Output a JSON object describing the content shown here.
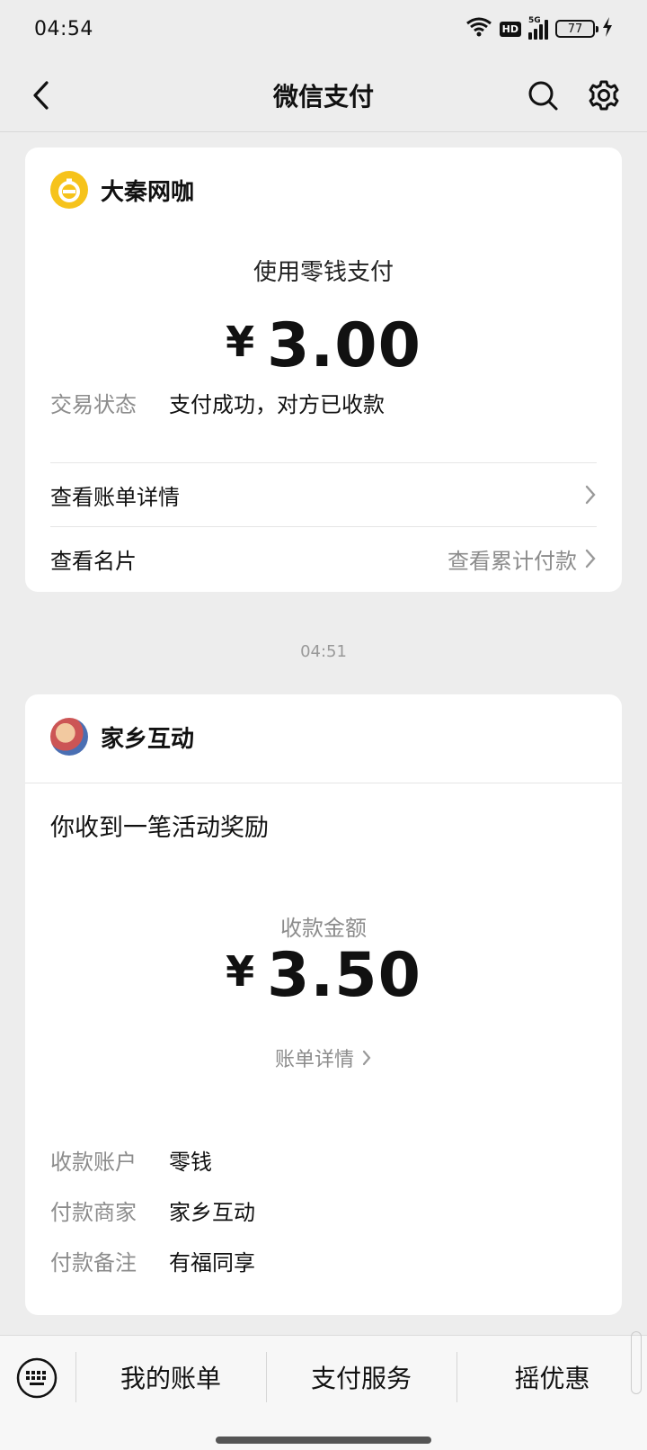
{
  "status": {
    "time": "04:54",
    "network": "5G",
    "hd": "HD",
    "battery": "77"
  },
  "nav": {
    "title": "微信支付"
  },
  "payment_card": {
    "merchant": "大秦网咖",
    "method": "使用零钱支付",
    "currency": "¥",
    "amount": "3.00",
    "status_key": "交易状态",
    "status_value": "支付成功，对方已收款",
    "bill_detail": "查看账单详情",
    "view_card": "查看名片",
    "view_total": "查看累计付款"
  },
  "timestamp": "04:51",
  "reward_card": {
    "merchant": "家乡互动",
    "message": "你收到一笔活动奖励",
    "amount_label": "收款金额",
    "currency": "¥",
    "amount": "3.50",
    "bill_detail": "账单详情",
    "rows": [
      {
        "key": "收款账户",
        "value": "零钱"
      },
      {
        "key": "付款商家",
        "value": "家乡互动"
      },
      {
        "key": "付款备注",
        "value": "有福同享"
      }
    ]
  },
  "bottom_menu": {
    "items": [
      "我的账单",
      "支付服务",
      "摇优惠"
    ]
  },
  "colors": {
    "logo_yellow": "#f6c31b",
    "background": "#ededed"
  }
}
